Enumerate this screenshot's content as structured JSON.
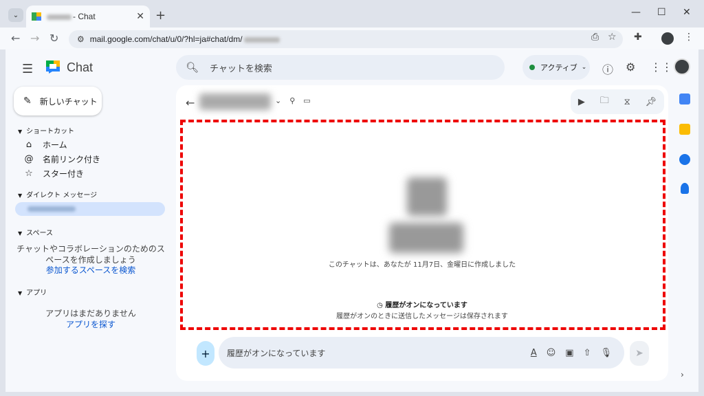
{
  "browser": {
    "tab_title_suffix": "- Chat",
    "url": "mail.google.com/chat/u/0/?hl=ja#chat/dm/",
    "tab_close": "✕",
    "new_tab": "+",
    "win_min": "—",
    "win_max": "☐",
    "win_close": "✕"
  },
  "app": {
    "name": "Chat",
    "search_placeholder": "チャットを検索",
    "status_label": "アクティブ",
    "status_color": "#1e8e3e"
  },
  "sidebar": {
    "new_chat": "新しいチャット",
    "shortcuts_header": "ショートカット",
    "shortcuts": [
      {
        "label": "ホーム",
        "icon": "home-icon"
      },
      {
        "label": "名前リンク付き",
        "icon": "at-icon"
      },
      {
        "label": "スター付き",
        "icon": "star-icon"
      }
    ],
    "dm_header": "ダイレクト メッセージ",
    "spaces_header": "スペース",
    "spaces_text": "チャットやコラボレーションのためのスペースを作成しましょう",
    "spaces_link": "参加するスペースを検索",
    "apps_header": "アプリ",
    "apps_text": "アプリはまだありません",
    "apps_link": "アプリを探す"
  },
  "conversation": {
    "created_text": "このチャットは、あなたが 11月7日、金曜日に作成しました",
    "history_title": "履歴がオンになっています",
    "history_sub": "履歴がオンのときに送信したメッセージは保存されます",
    "compose_placeholder": "履歴がオンになっています"
  },
  "colors": {
    "accent": "#0b57d0",
    "highlight_border": "#ee0000"
  }
}
